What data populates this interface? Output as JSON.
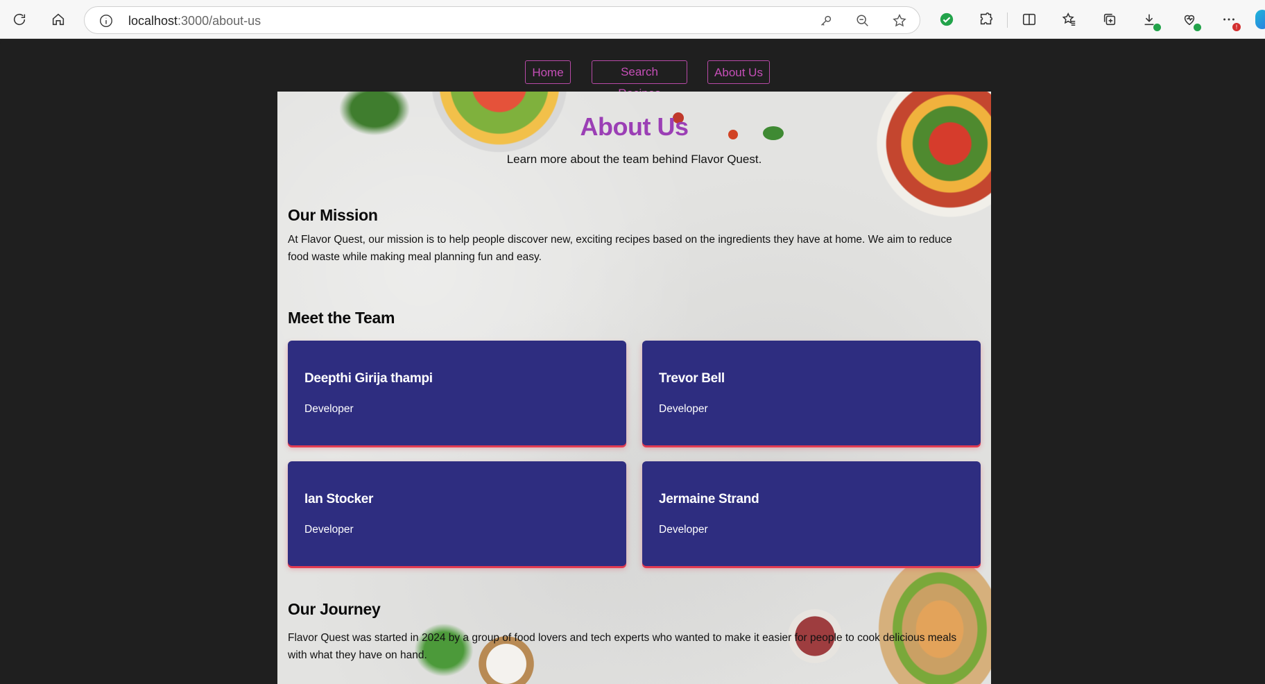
{
  "browser": {
    "url_host": "localhost",
    "url_rest": ":3000/about-us"
  },
  "nav": {
    "items": [
      {
        "label": "Home"
      },
      {
        "label": "Search Recipes"
      },
      {
        "label": "About Us"
      }
    ]
  },
  "page": {
    "title": "About Us",
    "subtitle": "Learn more about the team behind Flavor Quest.",
    "mission": {
      "heading": "Our Mission",
      "text": "At Flavor Quest, our mission is to help people discover new, exciting recipes based on the ingredients they have at home. We aim to reduce food waste while making meal planning fun and easy."
    },
    "team": {
      "heading": "Meet the Team",
      "members": [
        {
          "name": "Deepthi Girija thampi",
          "role": "Developer"
        },
        {
          "name": "Trevor Bell",
          "role": "Developer"
        },
        {
          "name": "Ian Stocker",
          "role": "Developer"
        },
        {
          "name": "Jermaine Strand",
          "role": "Developer"
        }
      ]
    },
    "journey": {
      "heading": "Our Journey",
      "text": "Flavor Quest was started in 2024 by a group of food lovers and tech experts who wanted to make it easier for people to cook delicious meals with what they have on hand."
    }
  },
  "colors": {
    "accent_purple": "#9b3fb5",
    "nav_border": "#b84aa8",
    "card_bg": "#2e2d80",
    "card_shadow": "#e23b52",
    "page_bg": "#1f1f1f"
  }
}
